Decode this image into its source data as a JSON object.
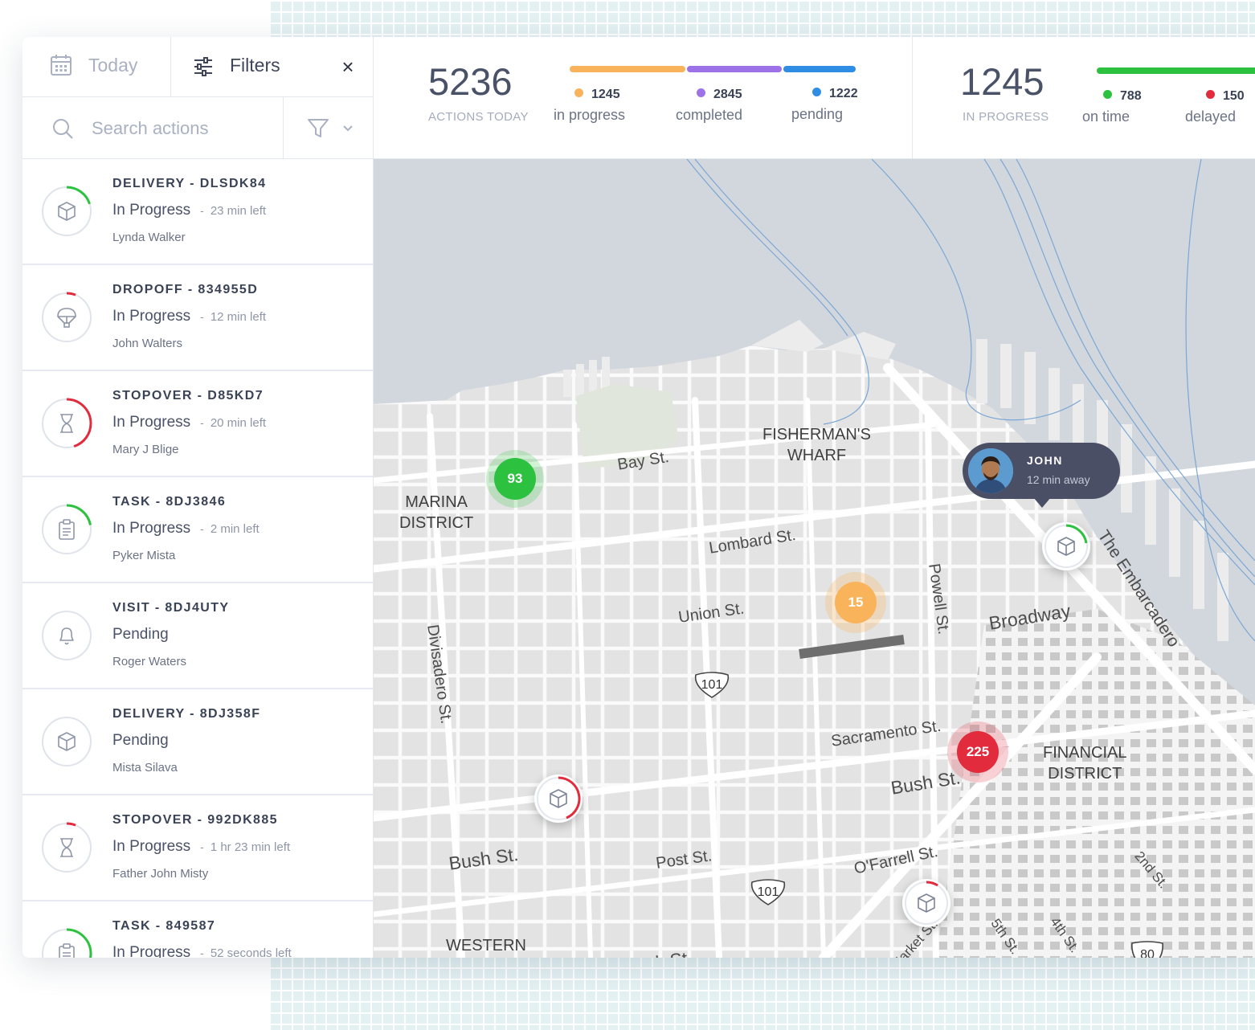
{
  "toolbar": {
    "date_label": "Today",
    "filters_label": "Filters",
    "close_symbol": "×",
    "search_placeholder": "Search actions"
  },
  "stats": {
    "total": {
      "value": "5236",
      "label": "ACTIONS TODAY",
      "segments": [
        {
          "value": "1245",
          "label": "in progress",
          "color": "#f9b35a"
        },
        {
          "value": "2845",
          "label": "completed",
          "color": "#9d72e8"
        },
        {
          "value": "1222",
          "label": "pending",
          "color": "#2f8de4"
        }
      ]
    },
    "in_progress": {
      "value": "1245",
      "label": "IN PROGRESS",
      "segments": [
        {
          "value": "788",
          "label": "on time",
          "color": "#2cc23f"
        },
        {
          "value": "150",
          "label": "delayed",
          "color": "#e22b3d"
        }
      ]
    }
  },
  "actions": [
    {
      "title": "DELIVERY - DLSDK84",
      "status": "In Progress",
      "time_left": "23 min left",
      "person": "Lynda Walker",
      "icon": "box-icon",
      "ring_color": "#2cc23f",
      "progress": 0.2
    },
    {
      "title": "DROPOFF - 834955D",
      "status": "In Progress",
      "time_left": "12 min left",
      "person": "John Walters",
      "icon": "parachute-icon",
      "ring_color": "#e22b3d",
      "progress": 0.06
    },
    {
      "title": "STOPOVER - D85KD7",
      "status": "In Progress",
      "time_left": "20 min left",
      "person": "Mary J Blige",
      "icon": "hourglass-icon",
      "ring_color": "#e22b3d",
      "progress": 0.45
    },
    {
      "title": "TASK - 8DJ3846",
      "status": "In Progress",
      "time_left": "2 min left",
      "person": "Pyker Mista",
      "icon": "clipboard-icon",
      "ring_color": "#2cc23f",
      "progress": 0.22
    },
    {
      "title": "VISIT - 8DJ4UTY",
      "status": "Pending",
      "time_left": "",
      "person": "Roger Waters",
      "icon": "bell-icon",
      "ring_color": "#2cc23f",
      "progress": 0
    },
    {
      "title": "DELIVERY - 8DJ358F",
      "status": "Pending",
      "time_left": "",
      "person": "Mista Silava",
      "icon": "box-icon",
      "ring_color": "#2cc23f",
      "progress": 0
    },
    {
      "title": "STOPOVER - 992DK885",
      "status": "In Progress",
      "time_left": "1 hr 23 min left",
      "person": "Father John Misty",
      "icon": "hourglass-icon",
      "ring_color": "#e22b3d",
      "progress": 0.06
    },
    {
      "title": "TASK - 849587",
      "status": "In Progress",
      "time_left": "52 seconds left",
      "person": "",
      "icon": "clipboard-icon",
      "ring_color": "#2cc23f",
      "progress": 0.3
    }
  ],
  "map": {
    "neighborhoods": [
      "MARINA\nDISTRICT",
      "FISHERMAN'S\nWHARF",
      "FINANCIAL\nDISTRICT",
      "WESTERN\nADDITION"
    ],
    "streets": [
      "Bay St.",
      "Lombard St.",
      "Union St.",
      "Broadway",
      "Sacramento St.",
      "Bush St.",
      "Post St.",
      "O'Farrell St.",
      "Turk St.",
      "Bush St.",
      "Divisadero St.",
      "Powell St.",
      "The Embarcadero",
      "2nd St.",
      "4th St.",
      "5th St.",
      "Market St."
    ],
    "shields": [
      "101",
      "101",
      "80"
    ],
    "clusters": [
      {
        "count": "93",
        "color": "#2cc23f"
      },
      {
        "count": "15",
        "color": "#f9b35a"
      },
      {
        "count": "225",
        "color": "#e22b3d"
      }
    ],
    "driver": {
      "name": "JOHN",
      "eta": "12 min away"
    }
  }
}
